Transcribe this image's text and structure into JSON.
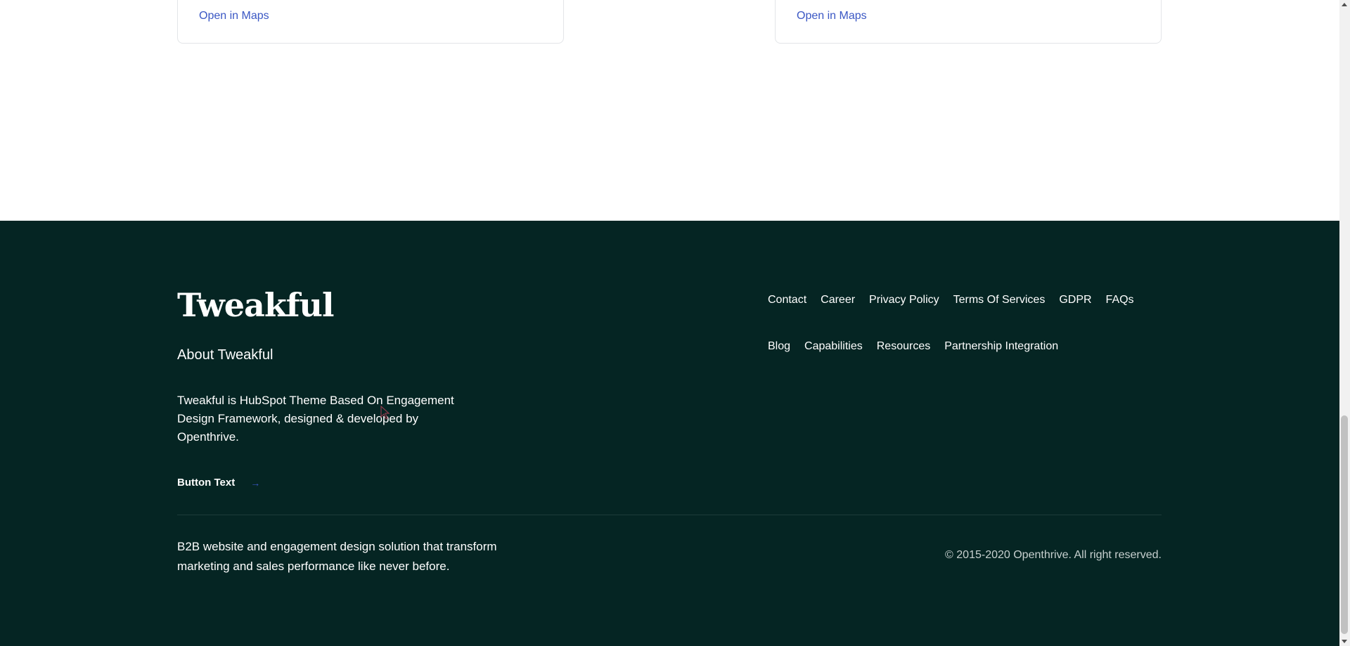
{
  "cards": [
    {
      "link_label": "Open in Maps"
    },
    {
      "link_label": "Open in Maps"
    }
  ],
  "footer": {
    "logo": "Tweakful",
    "about_title": "About Tweakful",
    "about_text": "Tweakful is HubSpot Theme Based On Engagement Design Framework, designed & developed by Openthrive.",
    "button_label": "Button Text",
    "button_arrow": "→",
    "nav_row_1": [
      "Contact",
      "Career",
      "Privacy Policy",
      "Terms Of Services",
      "GDPR",
      "FAQs"
    ],
    "nav_row_2": [
      "Blog",
      "Capabilities",
      "Resources",
      "Partnership Integration"
    ],
    "tagline": "B2B website and engagement design solution that transform marketing and sales performance like never before.",
    "copyright": "© 2015-2020 Openthrive. All right reserved."
  },
  "colors": {
    "footer_bg": "#052523",
    "link_blue": "#3a57c4"
  }
}
